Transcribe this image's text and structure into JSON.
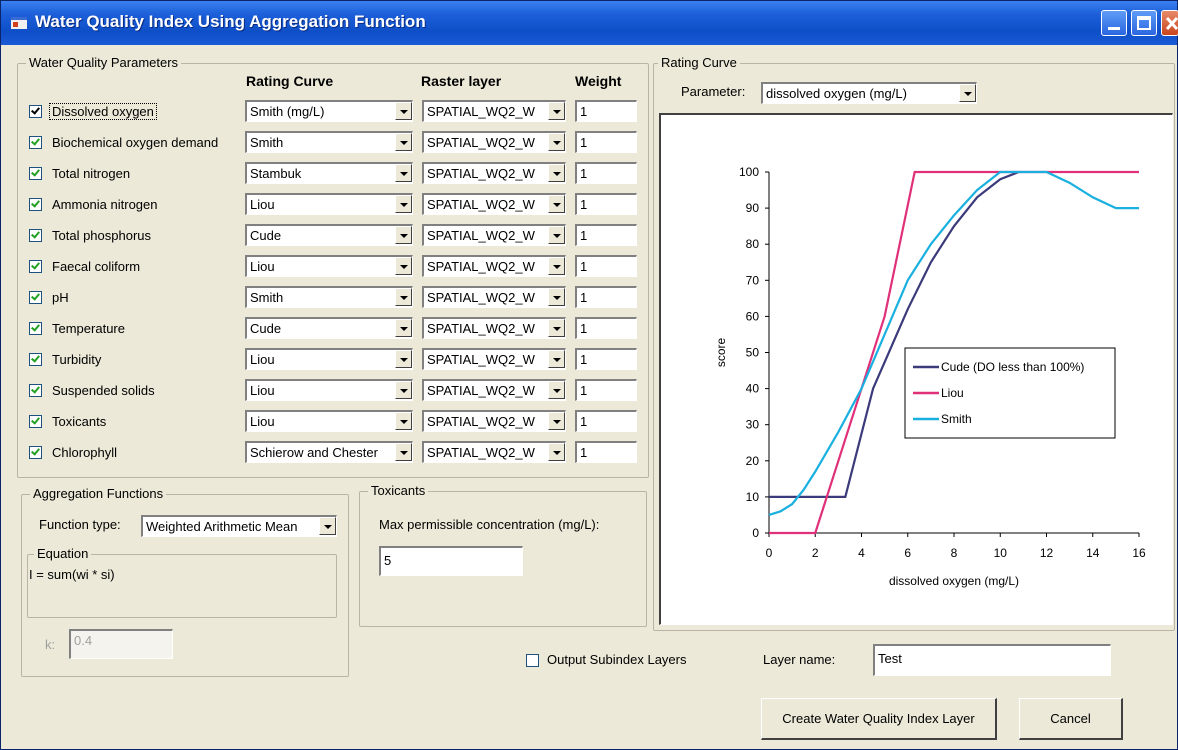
{
  "window": {
    "title": "Water Quality Index Using Aggregation Function"
  },
  "parameters": {
    "legend": "Water Quality Parameters",
    "col_rating": "Rating Curve",
    "col_raster": "Raster layer",
    "col_weight": "Weight",
    "rows": [
      {
        "name": "Dissolved oxygen",
        "checked": true,
        "rating": "Smith (mg/L)",
        "raster": "SPATIAL_WQ2_W",
        "weight": "1"
      },
      {
        "name": "Biochemical oxygen demand",
        "checked": true,
        "rating": "Smith",
        "raster": "SPATIAL_WQ2_W",
        "weight": "1"
      },
      {
        "name": "Total nitrogen",
        "checked": true,
        "rating": "Stambuk",
        "raster": "SPATIAL_WQ2_W",
        "weight": "1"
      },
      {
        "name": "Ammonia nitrogen",
        "checked": true,
        "rating": "Liou",
        "raster": "SPATIAL_WQ2_W",
        "weight": "1"
      },
      {
        "name": "Total phosphorus",
        "checked": true,
        "rating": "Cude",
        "raster": "SPATIAL_WQ2_W",
        "weight": "1"
      },
      {
        "name": "Faecal coliform",
        "checked": true,
        "rating": "Liou",
        "raster": "SPATIAL_WQ2_W",
        "weight": "1"
      },
      {
        "name": "pH",
        "checked": true,
        "rating": "Smith",
        "raster": "SPATIAL_WQ2_W",
        "weight": "1"
      },
      {
        "name": "Temperature",
        "checked": true,
        "rating": "Cude",
        "raster": "SPATIAL_WQ2_W",
        "weight": "1"
      },
      {
        "name": "Turbidity",
        "checked": true,
        "rating": "Liou",
        "raster": "SPATIAL_WQ2_W",
        "weight": "1"
      },
      {
        "name": "Suspended solids",
        "checked": true,
        "rating": "Liou",
        "raster": "SPATIAL_WQ2_W",
        "weight": "1"
      },
      {
        "name": "Toxicants",
        "checked": true,
        "rating": "Liou",
        "raster": "SPATIAL_WQ2_W",
        "weight": "1"
      },
      {
        "name": "Chlorophyll",
        "checked": true,
        "rating": "Schierow and Chester",
        "raster": "SPATIAL_WQ2_W",
        "weight": "1"
      }
    ]
  },
  "aggregation": {
    "legend": "Aggregation Functions",
    "function_type_label": "Function type:",
    "function_type_value": "Weighted Arithmetic Mean",
    "equation_legend": "Equation",
    "equation_text": "I = sum(wi * si)",
    "k_label": "k:",
    "k_value": "0.4"
  },
  "toxicants": {
    "legend": "Toxicants",
    "max_label": "Max permissible concentration (mg/L):",
    "max_value": "5"
  },
  "rating_curve": {
    "legend": "Rating Curve",
    "parameter_label": "Parameter:",
    "parameter_value": "dissolved oxygen (mg/L)"
  },
  "output": {
    "subindex_label": "Output Subindex Layers",
    "subindex_checked": false,
    "layer_name_label": "Layer name:",
    "layer_name_value": "Test"
  },
  "buttons": {
    "create": "Create Water Quality Index Layer",
    "cancel": "Cancel"
  },
  "chart_data": {
    "type": "line",
    "xlabel": "dissolved oxygen (mg/L)",
    "ylabel": "score",
    "xlim": [
      0,
      16
    ],
    "ylim": [
      0,
      100
    ],
    "xticks": [
      0,
      2,
      4,
      6,
      8,
      10,
      12,
      14,
      16
    ],
    "yticks": [
      0,
      10,
      20,
      30,
      40,
      50,
      60,
      70,
      80,
      90,
      100
    ],
    "grid": false,
    "legend_position": "center-right",
    "series": [
      {
        "name": "Cude (DO less than 100%)",
        "color": "#3b3a7a",
        "x": [
          0,
          3.3,
          4.5,
          6,
          7,
          8,
          9,
          10,
          10.8
        ],
        "y": [
          10,
          10,
          40,
          62,
          75,
          85,
          93,
          98,
          100
        ]
      },
      {
        "name": "Liou",
        "color": "#e0307a",
        "x": [
          0,
          2,
          3,
          4,
          5,
          6.3,
          8,
          10,
          12,
          14,
          16
        ],
        "y": [
          0,
          0,
          20,
          40,
          60,
          100,
          100,
          100,
          100,
          100,
          100
        ]
      },
      {
        "name": "Smith",
        "color": "#19b0e0",
        "x": [
          0,
          0.5,
          1,
          1.5,
          2,
          3,
          4,
          5,
          6,
          7,
          8,
          9,
          10,
          11,
          12,
          13,
          14,
          15,
          15.5,
          16
        ],
        "y": [
          5,
          6,
          8,
          12,
          17,
          28,
          40,
          55,
          70,
          80,
          88,
          95,
          100,
          100,
          100,
          97,
          93,
          90,
          90,
          90
        ]
      }
    ]
  }
}
